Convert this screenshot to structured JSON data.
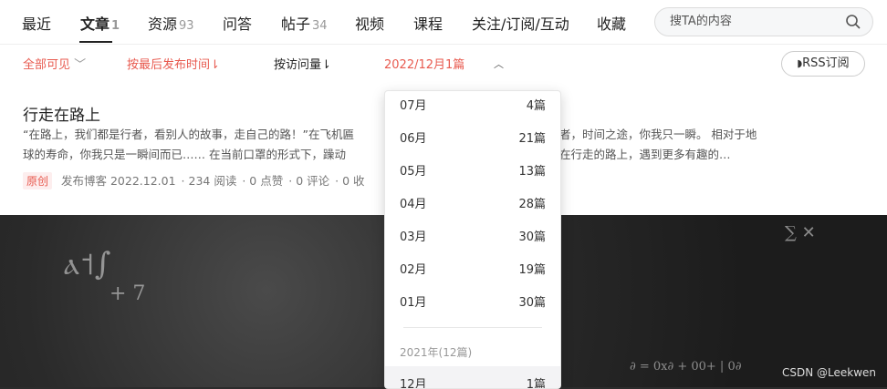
{
  "nav": {
    "tabs": [
      {
        "label": "最近",
        "count": ""
      },
      {
        "label": "文章",
        "count": "1"
      },
      {
        "label": "资源",
        "count": "93"
      },
      {
        "label": "问答",
        "count": ""
      },
      {
        "label": "帖子",
        "count": "34"
      },
      {
        "label": "视频",
        "count": ""
      },
      {
        "label": "课程",
        "count": ""
      },
      {
        "label": "关注/订阅/互动",
        "count": ""
      },
      {
        "label": "收藏",
        "count": ""
      }
    ],
    "search_placeholder": "搜TA的内容"
  },
  "filter": {
    "visibility": "全部可见",
    "sort_time": "按最后发布时间",
    "sort_visits": "按访问量",
    "date": "2022/12月1篇",
    "rss": "RSS订阅"
  },
  "article": {
    "title": "行走在路上",
    "desc_left": "“在路上，我们都是行者，看别人的故事，走自己的路！”在飞机匾",
    "desc_right": "路，你我皆行者，时间之途，你我只一瞬。 相对于地",
    "desc2_left": "球的寿命，你我只是一瞬间而已…… 在当前口罩的形式下，躁动",
    "desc2_right": "的迫使。 但愿我们在行走的路上，遇到更多有趣的…",
    "tag": "原创",
    "publish": "发布博客 2022.12.01",
    "reads": "234 阅读",
    "likes": "0 点赞",
    "comments": "0 评论",
    "favs": "0 收"
  },
  "dropdown": {
    "months": [
      {
        "month": "07月",
        "count": "4篇"
      },
      {
        "month": "06月",
        "count": "21篇"
      },
      {
        "month": "05月",
        "count": "13篇"
      },
      {
        "month": "04月",
        "count": "28篇"
      },
      {
        "month": "03月",
        "count": "30篇"
      },
      {
        "month": "02月",
        "count": "19篇"
      },
      {
        "month": "01月",
        "count": "30篇"
      }
    ],
    "year_header": "2021年(12篇)",
    "next_item": {
      "month": "12月",
      "count": "1篇"
    }
  },
  "watermark": "CSDN @Leekwen",
  "colors": {
    "accent": "#e85a4f",
    "text": "#222222"
  }
}
